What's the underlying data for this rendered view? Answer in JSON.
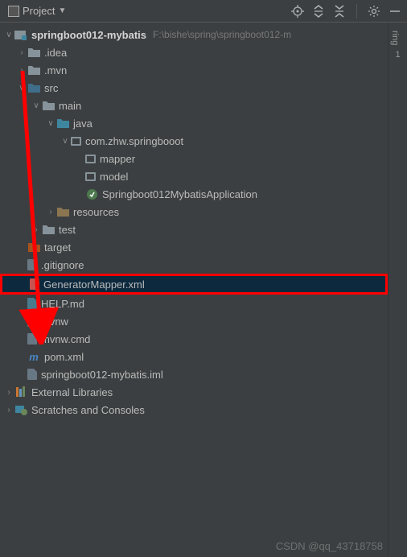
{
  "toolbar": {
    "project_label": "Project"
  },
  "right": {
    "tab": "ring",
    "num": "1"
  },
  "tree": {
    "root": {
      "name": "springboot012-mybatis",
      "path": "F:\\bishe\\spring\\springboot012-m"
    },
    "idea": ".idea",
    "mvn": ".mvn",
    "src": "src",
    "main": "main",
    "java": "java",
    "pkg": "com.zhw.springbooot",
    "mapper": "mapper",
    "model": "model",
    "app": "Springboot012MybatisApplication",
    "resources": "resources",
    "test": "test",
    "target": "target",
    "gitignore": ".gitignore",
    "genmapper": "GeneratorMapper.xml",
    "help": "HELP.md",
    "mvnw": "mvnw",
    "mvnwcmd": "mvnw.cmd",
    "pom": "pom.xml",
    "iml": "springboot012-mybatis.iml",
    "extlib": "External Libraries",
    "scratches": "Scratches and Consoles"
  },
  "watermark": "CSDN @qq_43718758"
}
